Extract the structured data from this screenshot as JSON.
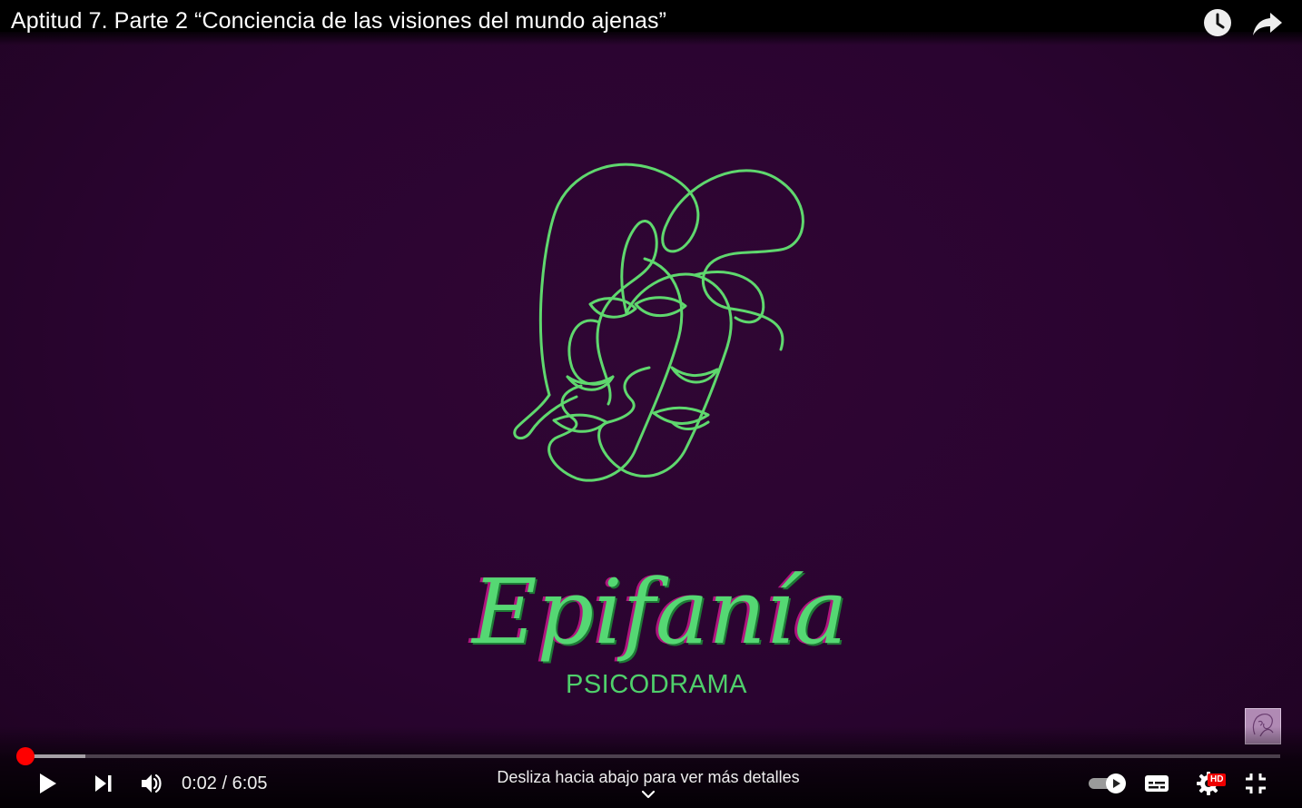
{
  "header": {
    "title": "Aptitud 7. Parte 2 “Conciencia de las visiones del mundo ajenas”",
    "watch_later_icon": "clock-icon",
    "share_icon": "share-arrow-icon"
  },
  "video_frame": {
    "brand_name": "Epifanía",
    "brand_subtitle": "PSICODRAMA",
    "logo_icon": "two-faces-line-art-icon",
    "channel_watermark_icon": "channel-logo-icon",
    "colors": {
      "background": "#2a0430",
      "logo_line": "#5fd86e",
      "brand_text": "#55d873",
      "brand_shadow": "#b0157e"
    }
  },
  "controls": {
    "play_icon": "play-icon",
    "next_icon": "skip-next-icon",
    "volume_icon": "volume-icon",
    "current_time": "0:02",
    "duration": "6:05",
    "time_separator": " / ",
    "swipe_hint": "Desliza hacia abajo para ver más detalles",
    "swipe_chevron_icon": "chevron-down-icon",
    "autoplay_icon": "autoplay-toggle-icon",
    "subtitles_icon": "subtitles-icon",
    "settings_icon": "gear-icon",
    "quality_badge": "HD",
    "fullscreen_icon": "exit-fullscreen-icon",
    "progress_played_fraction": 0.0055,
    "progress_buffered_fraction": 0.048,
    "colors": {
      "progress": "#ff0000"
    }
  }
}
